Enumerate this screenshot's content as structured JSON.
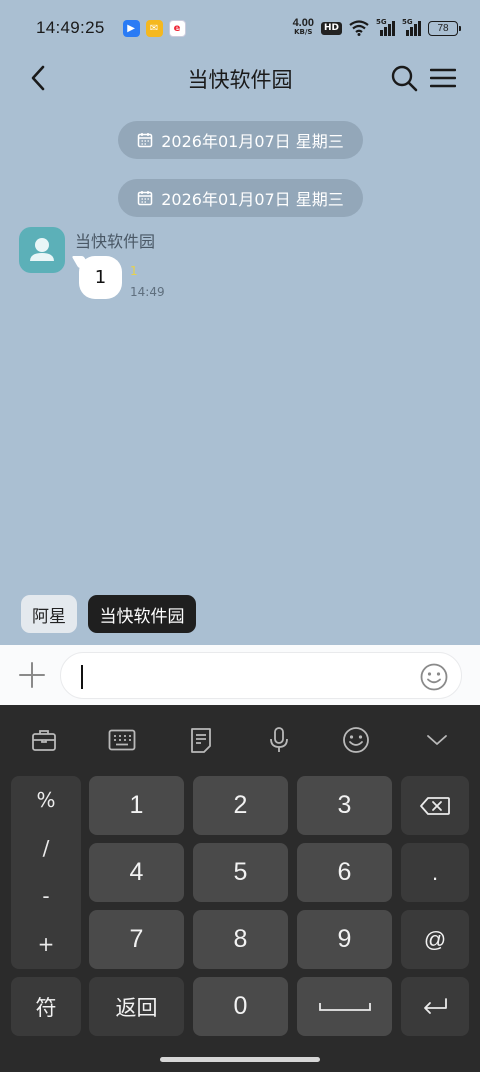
{
  "status": {
    "time": "14:49:25",
    "net_speed_value": "4.00",
    "net_speed_unit": "KB/S",
    "hd": "HD",
    "signal1": "5G",
    "signal2": "5G",
    "battery": "78"
  },
  "nav": {
    "title": "当快软件园"
  },
  "chat": {
    "date_chips": [
      "2026年01月07日 星期三",
      "2026年01月07日 星期三"
    ],
    "message": {
      "sender": "当快软件园",
      "text": "1",
      "read_mark": "1",
      "time": "14:49"
    }
  },
  "quick_chips": [
    "阿星",
    "当快软件园"
  ],
  "input": {
    "value": ""
  },
  "keyboard": {
    "symbols": [
      "%",
      "/",
      "-",
      "+"
    ],
    "digits": [
      "1",
      "2",
      "3",
      "4",
      "5",
      "6",
      "7",
      "8",
      "9",
      "0"
    ],
    "dot": ".",
    "at": "@",
    "symbol_key": "符",
    "return_key": "返回"
  },
  "colors": {
    "chat_bg": "#aabfd2",
    "keyboard_bg": "#2b2b2b",
    "key_bg": "#4a4a4a",
    "avatar": "#5cb0b8"
  }
}
